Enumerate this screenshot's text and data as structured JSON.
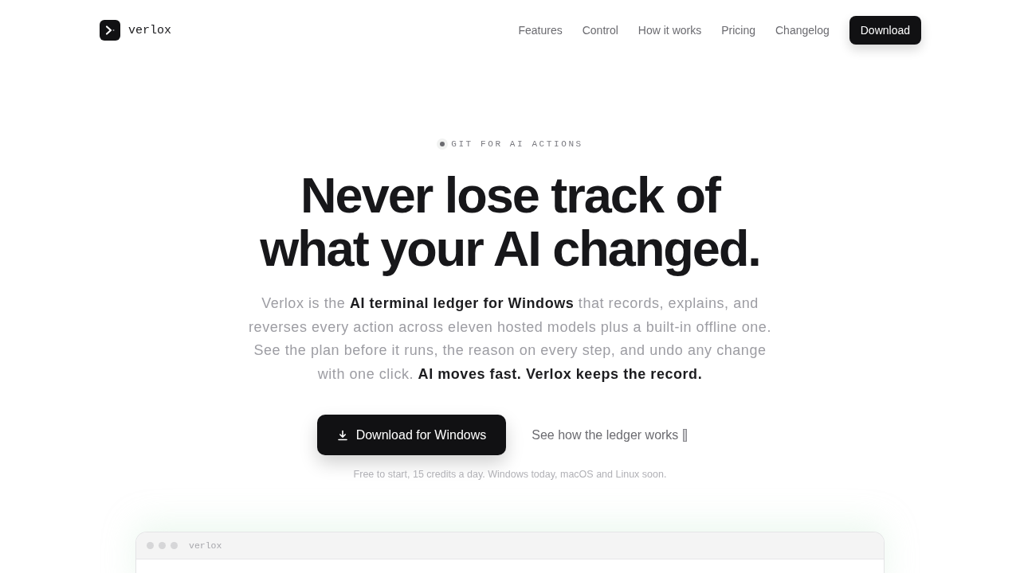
{
  "nav": {
    "brand": "verlox",
    "links": [
      "Features",
      "Control",
      "How it works",
      "Pricing",
      "Changelog"
    ],
    "cta": "Download"
  },
  "hero": {
    "eyebrow": "GIT FOR AI ACTIONS",
    "title_lines": [
      "Never lose track of",
      "what your AI changed."
    ],
    "lead": "Verlox is the **AI terminal ledger for Windows** that records, explains, and reverses every action across eleven hosted models plus a built-in offline one. See the plan before it runs, the reason on every step, and undo any change with one click. **AI moves fast. Verlox keeps the record.**",
    "primary_button": "Download for Windows",
    "secondary_link": "See how the ledger works",
    "note": "Free to start, 15 credits a day. Windows today, macOS and Linux soon."
  },
  "preview_window": {
    "title": "verlox"
  }
}
